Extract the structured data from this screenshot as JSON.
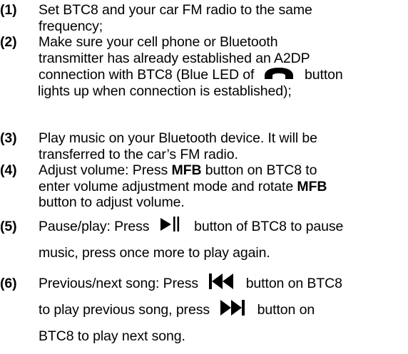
{
  "steps": [
    {
      "number": "(1)",
      "lines": [
        "Set BTC8 and your car FM radio to the same",
        "frequency;"
      ]
    },
    {
      "number": "(2)",
      "line1": "Make sure your cell phone or Bluetooth",
      "line2": "transmitter has already established an A2DP",
      "line3_before": "connection with BTC8 (Blue LED of",
      "line3_icon": "phone-handset-icon",
      "line3_after": "button",
      "line4": "lights up when connection is established);"
    },
    {
      "number": "(3)",
      "lines": [
        "Play music on your Bluetooth device. It will be",
        "transferred to the car’s FM radio."
      ]
    },
    {
      "number": "(4)",
      "line1_before": "Adjust volume: Press",
      "line1_bold": "MFB",
      "line1_after": "button on BTC8 to",
      "line2_before": "enter volume adjustment mode and rotate",
      "line2_bold": "MFB",
      "line3": "button to adjust volume."
    },
    {
      "number": "(5)",
      "line1_before": "Pause/play: Press",
      "line1_icon": "play-pause-icon",
      "line1_after": "button of BTC8 to pause",
      "line2": "music, press once more to play again."
    },
    {
      "number": "(6)",
      "line1_before": "Previous/next song: Press",
      "line1_icon": "previous-track-icon",
      "line1_after": "button on BTC8",
      "line2_before": "to play previous song, press",
      "line2_icon": "next-track-icon",
      "line2_after": "button on",
      "line3": "BTC8 to play next song."
    }
  ]
}
